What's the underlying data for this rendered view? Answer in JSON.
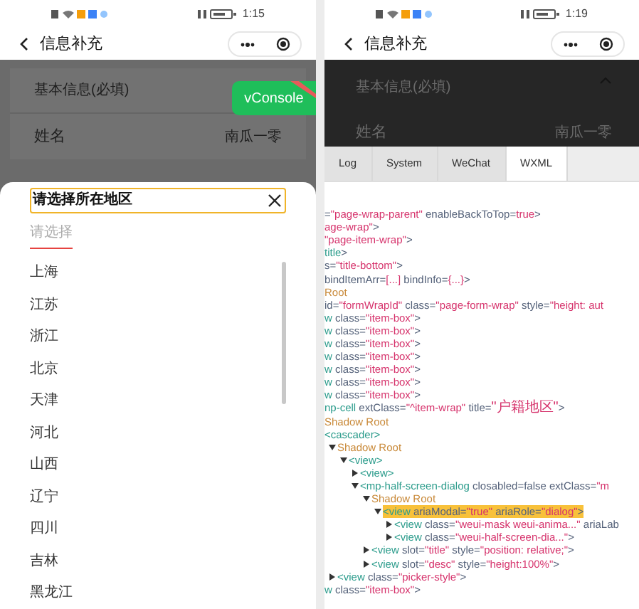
{
  "left": {
    "status_time": "1:15",
    "nav_title": "信息补充",
    "form": {
      "section_title": "基本信息(必填)",
      "rows": [
        {
          "label": "姓名",
          "value": "南瓜一零"
        }
      ]
    },
    "vconsole_button": "vConsole",
    "sheet": {
      "title": "请选择所在地区",
      "tabs": [
        {
          "label": "请选择",
          "selected": true
        }
      ],
      "options": [
        "上海",
        "江苏",
        "浙江",
        "北京",
        "天津",
        "河北",
        "山西",
        "辽宁",
        "四川",
        "吉林",
        "黑龙江"
      ]
    }
  },
  "right": {
    "status_time": "1:19",
    "nav_title": "信息补充",
    "form": {
      "section_title": "基本信息(必填)",
      "rows": [
        {
          "label": "姓名",
          "value": "南瓜一零"
        }
      ]
    },
    "console": {
      "tabs": [
        {
          "label": "Log",
          "selected": false
        },
        {
          "label": "System",
          "selected": false
        },
        {
          "label": "WeChat",
          "selected": false
        },
        {
          "label": "WXML",
          "selected": true
        }
      ],
      "tree": [
        {
          "segments": [
            {
              "kind": "punct",
              "text": "="
            },
            {
              "kind": "string",
              "text": "\"page-wrap-parent\""
            },
            {
              "kind": "attr",
              "text": " enableBackToTop="
            },
            {
              "kind": "string",
              "text": "true"
            },
            {
              "kind": "punct",
              "text": ">"
            }
          ]
        },
        {
          "segments": [
            {
              "kind": "string",
              "text": "age-wrap\""
            },
            {
              "kind": "punct",
              "text": ">"
            }
          ]
        },
        {
          "segments": [
            {
              "kind": "string",
              "text": "\"page-item-wrap\""
            },
            {
              "kind": "punct",
              "text": ">"
            }
          ]
        },
        {
          "segments": [
            {
              "kind": "tag",
              "text": "title"
            },
            {
              "kind": "punct",
              "text": ">"
            }
          ]
        },
        {
          "segments": [
            {
              "kind": "attr",
              "text": "s="
            },
            {
              "kind": "string",
              "text": "\"title-bottom\""
            },
            {
              "kind": "punct",
              "text": ">"
            }
          ]
        },
        {
          "segments": [
            {
              "kind": "attr",
              "text": " bindItemArr="
            },
            {
              "kind": "string",
              "text": "[...]"
            },
            {
              "kind": "attr",
              "text": " bindInfo="
            },
            {
              "kind": "string",
              "text": "{...}"
            },
            {
              "kind": "punct",
              "text": ">"
            }
          ]
        },
        {
          "segments": [
            {
              "kind": "root",
              "text": "Root"
            }
          ]
        },
        {
          "segments": [
            {
              "kind": "attr",
              "text": " id="
            },
            {
              "kind": "string",
              "text": "\"formWrapId\""
            },
            {
              "kind": "attr",
              "text": " class="
            },
            {
              "kind": "string",
              "text": "\"page-form-wrap\""
            },
            {
              "kind": "attr",
              "text": " style="
            },
            {
              "kind": "string",
              "text": "\"height: aut"
            }
          ]
        },
        {
          "segments": [
            {
              "kind": "tag",
              "text": "w"
            },
            {
              "kind": "attr",
              "text": " class="
            },
            {
              "kind": "string",
              "text": "\"item-box\""
            },
            {
              "kind": "punct",
              "text": ">"
            }
          ]
        },
        {
          "segments": [
            {
              "kind": "tag",
              "text": "w"
            },
            {
              "kind": "attr",
              "text": " class="
            },
            {
              "kind": "string",
              "text": "\"item-box\""
            },
            {
              "kind": "punct",
              "text": ">"
            }
          ]
        },
        {
          "segments": [
            {
              "kind": "tag",
              "text": "w"
            },
            {
              "kind": "attr",
              "text": " class="
            },
            {
              "kind": "string",
              "text": "\"item-box\""
            },
            {
              "kind": "punct",
              "text": ">"
            }
          ]
        },
        {
          "segments": [
            {
              "kind": "tag",
              "text": "w"
            },
            {
              "kind": "attr",
              "text": " class="
            },
            {
              "kind": "string",
              "text": "\"item-box\""
            },
            {
              "kind": "punct",
              "text": ">"
            }
          ]
        },
        {
          "segments": [
            {
              "kind": "tag",
              "text": "w"
            },
            {
              "kind": "attr",
              "text": " class="
            },
            {
              "kind": "string",
              "text": "\"item-box\""
            },
            {
              "kind": "punct",
              "text": ">"
            }
          ]
        },
        {
          "segments": [
            {
              "kind": "tag",
              "text": "w"
            },
            {
              "kind": "attr",
              "text": " class="
            },
            {
              "kind": "string",
              "text": "\"item-box\""
            },
            {
              "kind": "punct",
              "text": ">"
            }
          ]
        },
        {
          "segments": [
            {
              "kind": "tag",
              "text": "w"
            },
            {
              "kind": "attr",
              "text": " class="
            },
            {
              "kind": "string",
              "text": "\"item-box\""
            },
            {
              "kind": "punct",
              "text": ">"
            }
          ]
        },
        {
          "segments": [
            {
              "kind": "tag",
              "text": "np-cell"
            },
            {
              "kind": "attr",
              "text": " extClass="
            },
            {
              "kind": "string",
              "text": "\"^item-wrap\""
            },
            {
              "kind": "attr",
              "text": " title="
            },
            {
              "kind": "string",
              "text": "\"户籍地区\""
            },
            {
              "kind": "punct",
              "text": ">"
            }
          ]
        },
        {
          "segments": [
            {
              "kind": "root",
              "text": "Shadow Root"
            }
          ]
        },
        {
          "segments": [
            {
              "kind": "tag",
              "text": "<cascader>"
            }
          ]
        },
        {
          "expanded": true,
          "segments": [
            {
              "kind": "root",
              "text": "Shadow Root"
            }
          ],
          "children": [
            {
              "expanded": true,
              "segments": [
                {
                  "kind": "tag",
                  "text": "<view>"
                }
              ],
              "children": [
                {
                  "expanded": false,
                  "segments": [
                    {
                      "kind": "tag",
                      "text": "<view>"
                    }
                  ]
                },
                {
                  "expanded": true,
                  "segments": [
                    {
                      "kind": "tag",
                      "text": "<mp-half-screen-dialog"
                    },
                    {
                      "kind": "attr",
                      "text": " closabled=false extClass="
                    },
                    {
                      "kind": "string",
                      "text": "\"m"
                    }
                  ],
                  "children": [
                    {
                      "expanded": true,
                      "segments": [
                        {
                          "kind": "root",
                          "text": "Shadow Root"
                        }
                      ],
                      "children": [
                        {
                          "expanded": true,
                          "selected": true,
                          "segments": [
                            {
                              "kind": "tag",
                              "text": "<view"
                            },
                            {
                              "kind": "attr",
                              "text": " ariaModal="
                            },
                            {
                              "kind": "string",
                              "text": "\"true\""
                            },
                            {
                              "kind": "attr",
                              "text": " ariaRole="
                            },
                            {
                              "kind": "string",
                              "text": "\"dialog\""
                            },
                            {
                              "kind": "punct",
                              "text": ">"
                            }
                          ],
                          "children": [
                            {
                              "expanded": false,
                              "segments": [
                                {
                                  "kind": "tag",
                                  "text": "<view"
                                },
                                {
                                  "kind": "attr",
                                  "text": " class="
                                },
                                {
                                  "kind": "string",
                                  "text": "\"weui-mask weui-anima...\""
                                },
                                {
                                  "kind": "attr",
                                  "text": " ariaLab"
                                }
                              ]
                            },
                            {
                              "expanded": false,
                              "segments": [
                                {
                                  "kind": "tag",
                                  "text": "<view"
                                },
                                {
                                  "kind": "attr",
                                  "text": " class="
                                },
                                {
                                  "kind": "string",
                                  "text": "\"weui-half-screen-dia...\""
                                },
                                {
                                  "kind": "punct",
                                  "text": ">"
                                }
                              ]
                            }
                          ]
                        }
                      ]
                    },
                    {
                      "expanded": false,
                      "segments": [
                        {
                          "kind": "tag",
                          "text": "<view"
                        },
                        {
                          "kind": "attr",
                          "text": " slot="
                        },
                        {
                          "kind": "string",
                          "text": "\"title\""
                        },
                        {
                          "kind": "attr",
                          "text": " style="
                        },
                        {
                          "kind": "string",
                          "text": "\"position: relative;\""
                        },
                        {
                          "kind": "punct",
                          "text": ">"
                        }
                      ]
                    },
                    {
                      "expanded": false,
                      "segments": [
                        {
                          "kind": "tag",
                          "text": "<view"
                        },
                        {
                          "kind": "attr",
                          "text": " slot="
                        },
                        {
                          "kind": "string",
                          "text": "\"desc\""
                        },
                        {
                          "kind": "attr",
                          "text": " style="
                        },
                        {
                          "kind": "string",
                          "text": "\"height:100%\""
                        },
                        {
                          "kind": "punct",
                          "text": ">"
                        }
                      ]
                    }
                  ]
                }
              ]
            }
          ]
        },
        {
          "expanded": false,
          "segments": [
            {
              "kind": "tag",
              "text": "<view"
            },
            {
              "kind": "attr",
              "text": " class="
            },
            {
              "kind": "string",
              "text": "\"picker-style\""
            },
            {
              "kind": "punct",
              "text": ">"
            }
          ]
        },
        {
          "segments": [
            {
              "kind": "tag",
              "text": "w"
            },
            {
              "kind": "attr",
              "text": " class="
            },
            {
              "kind": "string",
              "text": "\"item-box\""
            },
            {
              "kind": "punct",
              "text": ">"
            }
          ]
        }
      ]
    }
  }
}
